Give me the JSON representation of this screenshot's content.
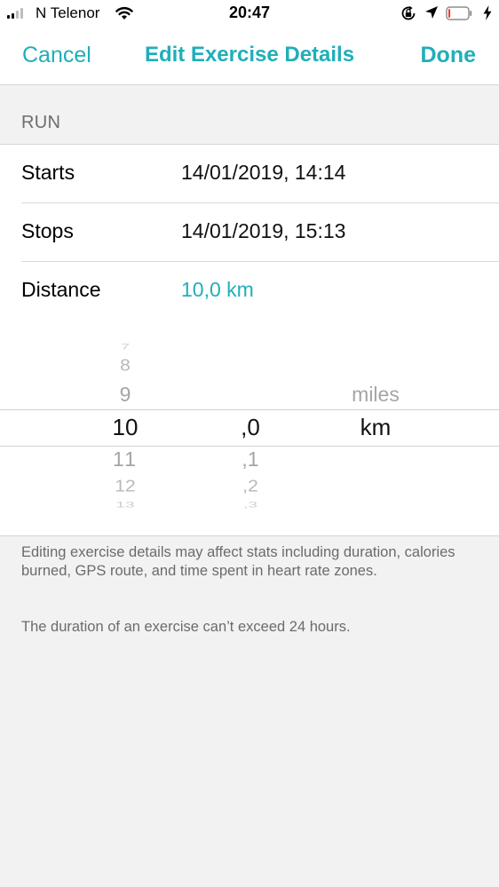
{
  "status_bar": {
    "carrier": "N Telenor",
    "time": "20:47",
    "signal_bars_filled": 2,
    "signal_bars_total": 4,
    "battery_level_percent": 10,
    "battery_color": "#ff3b30",
    "icons": [
      "signal-icon",
      "wifi-icon",
      "rotation-lock-icon",
      "location-arrow-icon",
      "battery-icon",
      "charging-bolt-icon"
    ]
  },
  "nav": {
    "cancel_label": "Cancel",
    "title": "Edit Exercise Details",
    "done_label": "Done"
  },
  "section": {
    "header": "RUN"
  },
  "rows": [
    {
      "label": "Starts",
      "value": "14/01/2019, 14:14"
    },
    {
      "label": "Stops",
      "value": "14/01/2019, 15:13"
    },
    {
      "label": "Distance",
      "value": "10,0 km"
    }
  ],
  "picker": {
    "integer_column": {
      "items": [
        "7",
        "8",
        "9",
        "10",
        "11",
        "12",
        "13"
      ],
      "selected": "10"
    },
    "decimal_column": {
      "items": [
        ",0",
        ",1",
        ",2",
        ",3"
      ],
      "selected": ",0"
    },
    "unit_column": {
      "items": [
        "miles",
        "km"
      ],
      "selected": "km"
    }
  },
  "footer": {
    "note_1": "Editing exercise details may affect stats including duration, calories burned, GPS route, and time spent in heart rate zones.",
    "note_2": "The duration of an exercise can’t exceed 24 hours."
  },
  "colors": {
    "accent": "#20afb8",
    "background": "#f2f2f2",
    "surface": "#ffffff",
    "secondary_text": "#6b6b6b"
  }
}
